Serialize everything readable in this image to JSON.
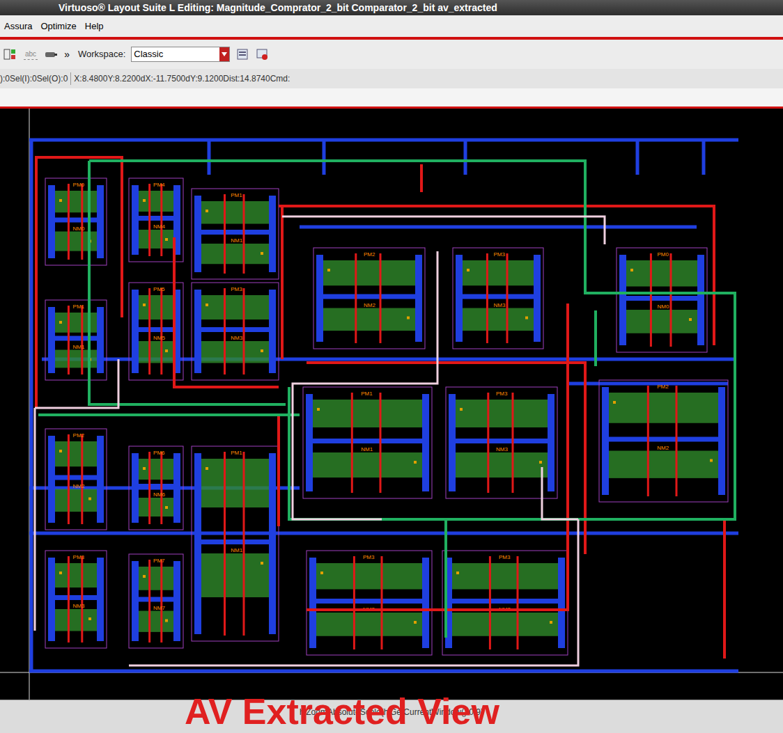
{
  "window": {
    "title": "Virtuoso® Layout Suite L Editing: Magnitude_Comprator_2_bit Comparator_2_bit av_extracted"
  },
  "menu": [
    {
      "label": "Assura"
    },
    {
      "label": "Optimize"
    },
    {
      "label": "Help"
    }
  ],
  "toolbar": {
    "icon_text": "abc",
    "more": "»",
    "workspace_label": "Workspace:",
    "workspace_value": "Classic"
  },
  "status": {
    "selection": "):0Sel(I):0Sel(O):0",
    "coordinates": "X:8.4800Y:8.2200dX:-11.7500dY:9.1200Dist:14.8740Cmd:"
  },
  "canvas": {
    "cells": [
      {
        "pmos": "PM0",
        "nmos": "NM0"
      },
      {
        "pmos": "PM1",
        "nmos": "NM1"
      },
      {
        "pmos": "PM2",
        "nmos": "NM2"
      },
      {
        "pmos": "PM3",
        "nmos": "NM3"
      },
      {
        "pmos": "PM4",
        "nmos": "NM4"
      },
      {
        "pmos": "PM5",
        "nmos": "NM5"
      },
      {
        "pmos": "PM6",
        "nmos": "NM6"
      },
      {
        "pmos": "PM7",
        "nmos": "NM7"
      },
      {
        "pmos": "PM1",
        "nmos": "NM1"
      },
      {
        "pmos": "PM3",
        "nmos": "NM3"
      },
      {
        "pmos": "PM1",
        "nmos": "NM1"
      },
      {
        "pmos": "PM2",
        "nmos": "NM2"
      },
      {
        "pmos": "PM3",
        "nmos": "NM3"
      },
      {
        "pmos": "PM0",
        "nmos": "NM0"
      },
      {
        "pmos": "PM1",
        "nmos": "NM1"
      },
      {
        "pmos": "PM3",
        "nmos": "NM3"
      },
      {
        "pmos": "PM2",
        "nmos": "NM2"
      },
      {
        "pmos": "PM3",
        "nmos": "NM3"
      },
      {
        "pmos": "PM3",
        "nmos": "NM3"
      }
    ]
  },
  "command_line": "hiZoomAbsoluteScale(hiGetCurrentWindow() 0.9)",
  "overlay": "AV Extracted View"
}
